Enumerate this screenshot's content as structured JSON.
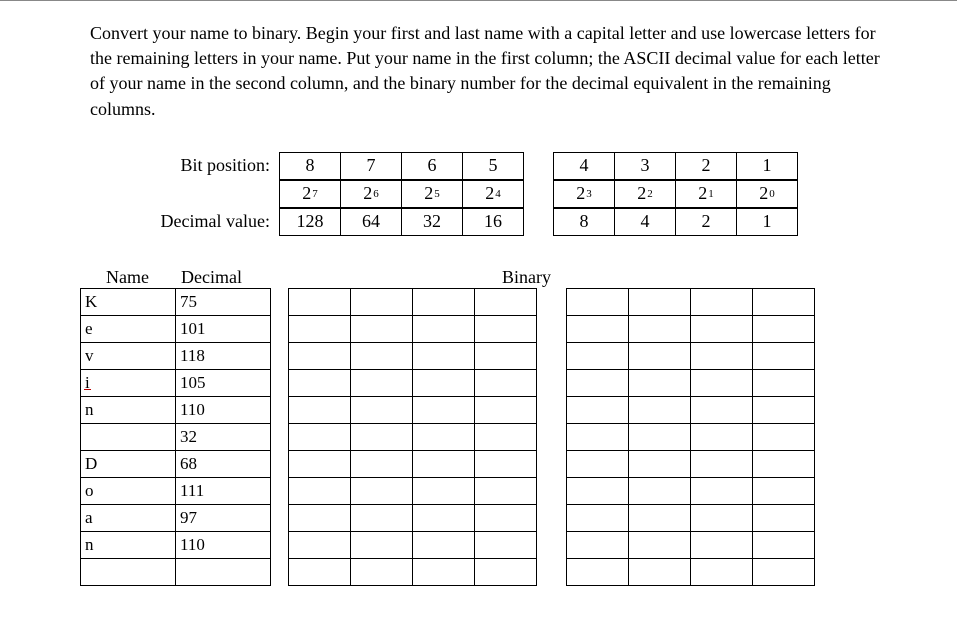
{
  "instructions": "Convert your name to binary. Begin your first and last name with a capital letter and use lowercase letters for the remaining letters in your name. Put your name in the first column; the ASCII decimal value for each letter of your name in the second column, and the binary number for the decimal equivalent in the remaining columns.",
  "bit_header": {
    "label_bit": "Bit position:",
    "label_dec": "Decimal value:",
    "bits": [
      "8",
      "7",
      "6",
      "5",
      "4",
      "3",
      "2",
      "1"
    ],
    "powers_base": [
      "2",
      "2",
      "2",
      "2",
      "2",
      "2",
      "2",
      "2"
    ],
    "powers_exp": [
      "7",
      "6",
      "5",
      "4",
      "3",
      "2",
      "1",
      "0"
    ],
    "decimals": [
      "128",
      "64",
      "32",
      "16",
      "8",
      "4",
      "2",
      "1"
    ]
  },
  "columns": {
    "name": "Name",
    "decimal": "Decimal",
    "binary": "Binary"
  },
  "rows": [
    {
      "letter": "K",
      "decimal": "75",
      "flag": false
    },
    {
      "letter": "e",
      "decimal": "101",
      "flag": false
    },
    {
      "letter": "v",
      "decimal": "118",
      "flag": false
    },
    {
      "letter": "i",
      "decimal": "105",
      "flag": true
    },
    {
      "letter": "n",
      "decimal": "110",
      "flag": false
    },
    {
      "letter": "",
      "decimal": "32",
      "flag": false
    },
    {
      "letter": "D",
      "decimal": "68",
      "flag": false
    },
    {
      "letter": "o",
      "decimal": "111",
      "flag": false
    },
    {
      "letter": "a",
      "decimal": "97",
      "flag": false
    },
    {
      "letter": "n",
      "decimal": "110",
      "flag": false
    },
    {
      "letter": "",
      "decimal": "",
      "flag": false
    }
  ],
  "chart_data": {
    "type": "table",
    "title": "ASCII to binary worksheet",
    "columns": [
      "Name",
      "Decimal",
      "b128",
      "b64",
      "b32",
      "b16",
      "b8",
      "b4",
      "b2",
      "b1"
    ],
    "rows": [
      [
        "K",
        "75",
        "",
        "",
        "",
        "",
        "",
        "",
        "",
        ""
      ],
      [
        "e",
        "101",
        "",
        "",
        "",
        "",
        "",
        "",
        "",
        ""
      ],
      [
        "v",
        "118",
        "",
        "",
        "",
        "",
        "",
        "",
        "",
        ""
      ],
      [
        "i",
        "105",
        "",
        "",
        "",
        "",
        "",
        "",
        "",
        ""
      ],
      [
        "n",
        "110",
        "",
        "",
        "",
        "",
        "",
        "",
        "",
        ""
      ],
      [
        "",
        "32",
        "",
        "",
        "",
        "",
        "",
        "",
        "",
        ""
      ],
      [
        "D",
        "68",
        "",
        "",
        "",
        "",
        "",
        "",
        "",
        ""
      ],
      [
        "o",
        "111",
        "",
        "",
        "",
        "",
        "",
        "",
        "",
        ""
      ],
      [
        "a",
        "97",
        "",
        "",
        "",
        "",
        "",
        "",
        "",
        ""
      ],
      [
        "n",
        "110",
        "",
        "",
        "",
        "",
        "",
        "",
        "",
        ""
      ],
      [
        "",
        "",
        "",
        "",
        "",
        "",
        "",
        "",
        "",
        ""
      ]
    ]
  }
}
